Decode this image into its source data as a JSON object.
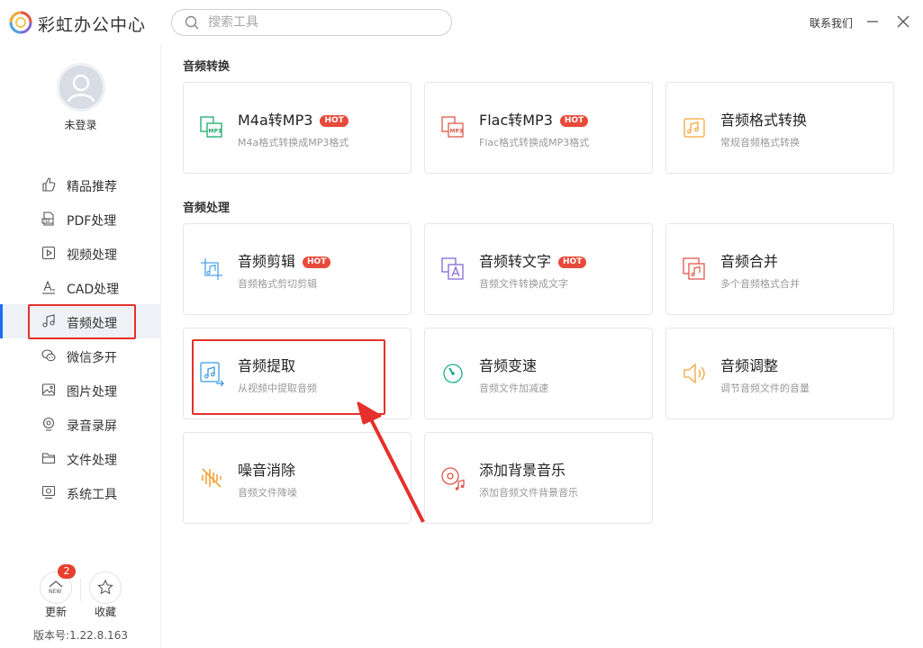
{
  "app": {
    "title": "彩虹办公中心",
    "contact": "联系我们"
  },
  "search": {
    "placeholder": "搜索工具"
  },
  "user": {
    "login_text": "未登录"
  },
  "sidebar": {
    "items": [
      {
        "label": "精品推荐",
        "icon": "thumbs-up-icon"
      },
      {
        "label": "PDF处理",
        "icon": "pdf-icon"
      },
      {
        "label": "视频处理",
        "icon": "video-icon"
      },
      {
        "label": "CAD处理",
        "icon": "cad-icon"
      },
      {
        "label": "音频处理",
        "icon": "music-note-icon",
        "active": true
      },
      {
        "label": "微信多开",
        "icon": "wechat-icon"
      },
      {
        "label": "图片处理",
        "icon": "image-icon"
      },
      {
        "label": "录音录屏",
        "icon": "record-icon"
      },
      {
        "label": "文件处理",
        "icon": "folder-icon"
      },
      {
        "label": "系统工具",
        "icon": "system-icon"
      }
    ],
    "update": {
      "label": "更新",
      "badge": "2",
      "icon_text": "NEW"
    },
    "favorite": {
      "label": "收藏"
    },
    "version": "版本号:1.22.8.163"
  },
  "sections": [
    {
      "title": "音频转换",
      "cards": [
        {
          "title": "M4a转MP3",
          "hot": "HOT",
          "desc": "M4a格式转换成MP3格式",
          "icon": "m4a-to-mp3-icon",
          "color": "#1aab6b"
        },
        {
          "title": "Flac转MP3",
          "hot": "HOT",
          "desc": "Flac格式转换成MP3格式",
          "icon": "flac-to-mp3-icon",
          "color": "#e0574c"
        },
        {
          "title": "音频格式转换",
          "hot": "",
          "desc": "常规音频格式转换",
          "icon": "audio-format-convert-icon",
          "color": "#f2a53a"
        }
      ]
    },
    {
      "title": "音频处理",
      "cards": [
        {
          "title": "音频剪辑",
          "hot": "HOT",
          "desc": "音频格式剪切剪辑",
          "icon": "audio-cut-icon",
          "color": "#4aa3e8"
        },
        {
          "title": "音频转文字",
          "hot": "HOT",
          "desc": "音频文件转换成文字",
          "icon": "audio-to-text-icon",
          "color": "#7f6ad8"
        },
        {
          "title": "音频合并",
          "hot": "",
          "desc": "多个音频格式合并",
          "icon": "audio-merge-icon",
          "color": "#e0574c"
        },
        {
          "title": "音频提取",
          "hot": "",
          "desc": "从视频中提取音频",
          "icon": "audio-extract-icon",
          "color": "#3b9be6"
        },
        {
          "title": "音频变速",
          "hot": "",
          "desc": "音频文件加减速",
          "icon": "audio-speed-icon",
          "color": "#1aab8a"
        },
        {
          "title": "音频调整",
          "hot": "",
          "desc": "调节音频文件的音量",
          "icon": "volume-adjust-icon",
          "color": "#f2a53a"
        },
        {
          "title": "噪音消除",
          "hot": "",
          "desc": "音频文件降噪",
          "icon": "noise-remove-icon",
          "color": "#f2a53a"
        },
        {
          "title": "添加背景音乐",
          "hot": "",
          "desc": "添加音频文件背景音乐",
          "icon": "add-bgm-icon",
          "color": "#e0574c"
        }
      ]
    }
  ],
  "colors": {
    "accent": "#1b6ef3",
    "annotation_red": "#e5302b",
    "hot_badge": "#e84a3a"
  }
}
